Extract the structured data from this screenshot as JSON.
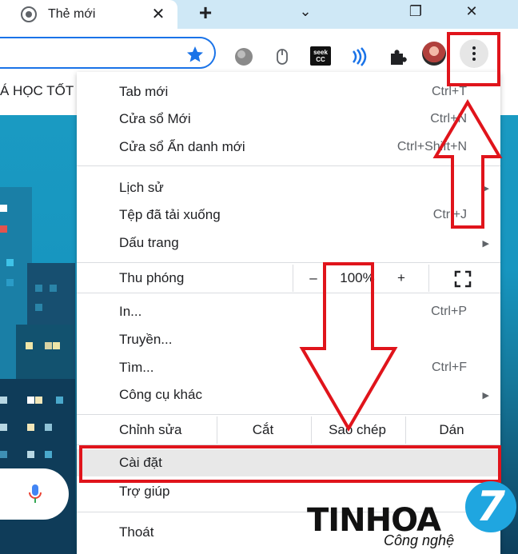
{
  "tab": {
    "title": "Thẻ mới",
    "close": "✕"
  },
  "window": {
    "newtab": "+",
    "minimize": "⌄",
    "restore": "❐",
    "close": "✕"
  },
  "bookmark": {
    "label": "Á HỌC TỐT"
  },
  "extensions": {
    "seek_line1": "seek",
    "seek_line2": "CC"
  },
  "menu": {
    "new_tab": {
      "label": "Tab mới",
      "shortcut": "Ctrl+T"
    },
    "new_window": {
      "label": "Cửa sổ Mới",
      "shortcut": "Ctrl+N"
    },
    "incognito": {
      "label": "Cửa sổ Ẩn danh mới",
      "shortcut": "Ctrl+Shift+N"
    },
    "history": {
      "label": "Lịch sử"
    },
    "downloads": {
      "label": "Tệp đã tải xuống",
      "shortcut": "Ctrl+J"
    },
    "bookmarks": {
      "label": "Dấu trang"
    },
    "zoom": {
      "label": "Thu phóng",
      "minus": "–",
      "value": "100%",
      "plus": "+"
    },
    "print": {
      "label": "In...",
      "shortcut": "Ctrl+P"
    },
    "cast": {
      "label": "Truyền..."
    },
    "find": {
      "label": "Tìm...",
      "shortcut": "Ctrl+F"
    },
    "more_tools": {
      "label": "Công cụ khác"
    },
    "edit": {
      "label": "Chỉnh sửa",
      "cut": "Cắt",
      "copy": "Sao chép",
      "paste": "Dán"
    },
    "settings": {
      "label": "Cài đặt"
    },
    "help": {
      "label": "Trợ giúp"
    },
    "exit": {
      "label": "Thoát"
    }
  },
  "watermark": {
    "brand": "TINHOA",
    "tagline": "Công nghệ",
    "number": "7"
  },
  "colors": {
    "annotation_red": "#e0141b",
    "accent_blue": "#1a73e8",
    "tabstrip": "#cfe8f6"
  }
}
